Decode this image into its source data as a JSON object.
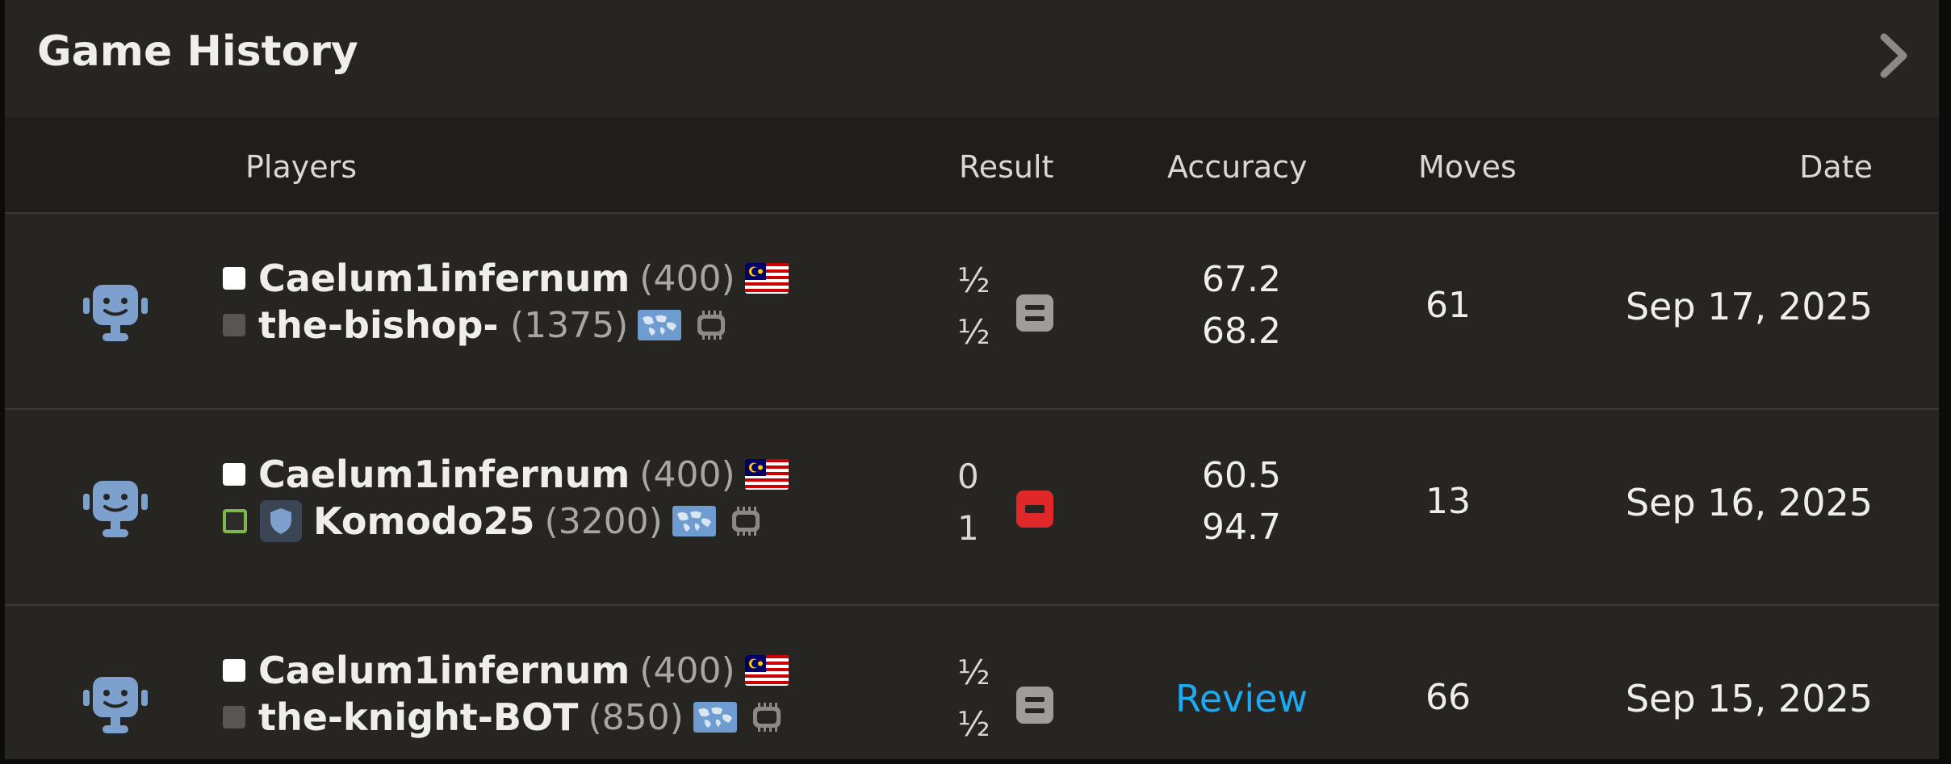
{
  "header": {
    "title": "Game History",
    "next_icon": "chevron-right-icon"
  },
  "columns": {
    "players": "Players",
    "result": "Result",
    "accuracy": "Accuracy",
    "moves": "Moves",
    "date": "Date"
  },
  "colors": {
    "draw": "#9e9d9a",
    "loss": "#e02828",
    "review_link": "#1baaf5",
    "green_border": "#81b64c"
  },
  "games": [
    {
      "opponent_type": "bot",
      "white": {
        "name": "Caelum1infernum",
        "rating": "(400)",
        "flag": "malaysia-flag"
      },
      "black": {
        "name": "the-bishop-…",
        "rating": "(1375)",
        "flag": "international-flag",
        "badge": "cpu-icon"
      },
      "score_white": "½",
      "score_black": "½",
      "result": "draw",
      "accuracy_white": "67.2",
      "accuracy_black": "68.2",
      "moves": "61",
      "date": "Sep 17, 2025"
    },
    {
      "opponent_type": "bot",
      "white": {
        "name": "Caelum1infernum",
        "rating": "(400)",
        "flag": "malaysia-flag"
      },
      "black": {
        "name": "Komodo25",
        "rating": "(3200)",
        "flag": "international-flag",
        "badge": "cpu-icon",
        "shield": "shield-icon"
      },
      "score_white": "0",
      "score_black": "1",
      "result": "loss",
      "accuracy_white": "60.5",
      "accuracy_black": "94.7",
      "moves": "13",
      "date": "Sep 16, 2025"
    },
    {
      "opponent_type": "bot",
      "white": {
        "name": "Caelum1infernum",
        "rating": "(400)",
        "flag": "malaysia-flag"
      },
      "black": {
        "name": "the-knight-BOT",
        "rating": "(850)",
        "flag": "international-flag",
        "badge": "cpu-icon"
      },
      "score_white": "½",
      "score_black": "½",
      "result": "draw",
      "review_label": "Review",
      "moves": "66",
      "date": "Sep 15, 2025"
    }
  ]
}
